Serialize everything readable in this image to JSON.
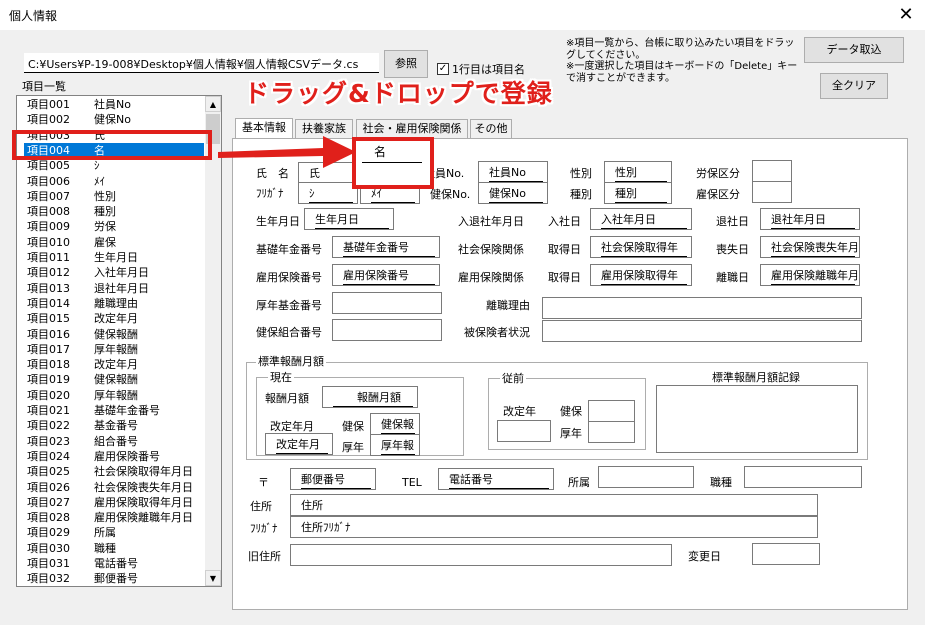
{
  "window": {
    "title": "個人情報",
    "close_icon": "close-icon"
  },
  "top": {
    "path_value": "C:¥Users¥P-19-008¥Desktop¥個人情報¥個人情報CSVデータ.cs",
    "browse_label": "参照",
    "first_row_label": "1行目は項目名",
    "first_row_checked": true,
    "note_line1": "※項目一覧から、台帳に取り込みたい項目をドラッ",
    "note_line2": "グしてください。",
    "note_line3": "※一度選択した項目はキーボードの「Delete」キー",
    "note_line4": "で消すことができます。",
    "import_label": "データ取込",
    "clear_label": "全クリア"
  },
  "item_list": {
    "title": "項目一覧",
    "rows": [
      {
        "id": "項目001",
        "name": "社員No"
      },
      {
        "id": "項目002",
        "name": "健保No"
      },
      {
        "id": "項目003",
        "name": "氏"
      },
      {
        "id": "項目004",
        "name": "名"
      },
      {
        "id": "項目005",
        "name": "ｼ"
      },
      {
        "id": "項目006",
        "name": "ﾒｲ"
      },
      {
        "id": "項目007",
        "name": "性別"
      },
      {
        "id": "項目008",
        "name": "種別"
      },
      {
        "id": "項目009",
        "name": "労保"
      },
      {
        "id": "項目010",
        "name": "雇保"
      },
      {
        "id": "項目011",
        "name": "生年月日"
      },
      {
        "id": "項目012",
        "name": "入社年月日"
      },
      {
        "id": "項目013",
        "name": "退社年月日"
      },
      {
        "id": "項目014",
        "name": "離職理由"
      },
      {
        "id": "項目015",
        "name": "改定年月"
      },
      {
        "id": "項目016",
        "name": "健保報酬"
      },
      {
        "id": "項目017",
        "name": "厚年報酬"
      },
      {
        "id": "項目018",
        "name": "改定年月"
      },
      {
        "id": "項目019",
        "name": "健保報酬"
      },
      {
        "id": "項目020",
        "name": "厚年報酬"
      },
      {
        "id": "項目021",
        "name": "基礎年金番号"
      },
      {
        "id": "項目022",
        "name": "基金番号"
      },
      {
        "id": "項目023",
        "name": "組合番号"
      },
      {
        "id": "項目024",
        "name": "雇用保険番号"
      },
      {
        "id": "項目025",
        "name": "社会保険取得年月日"
      },
      {
        "id": "項目026",
        "name": "社会保険喪失年月日"
      },
      {
        "id": "項目027",
        "name": "雇用保険取得年月日"
      },
      {
        "id": "項目028",
        "name": "雇用保険離職年月日"
      },
      {
        "id": "項目029",
        "name": "所属"
      },
      {
        "id": "項目030",
        "name": "職種"
      },
      {
        "id": "項目031",
        "name": "電話番号"
      },
      {
        "id": "項目032",
        "name": "郵便番号"
      }
    ],
    "selected_index": 3,
    "scroll_up_icon": "triangle-up-icon",
    "scroll_down_icon": "triangle-down-icon"
  },
  "overlay": {
    "instruction": "ドラッグ&ドロップで登録",
    "arrow_icon": "right-arrow-icon",
    "drop_value": "名"
  },
  "tabs": [
    "基本情報",
    "扶養家族",
    "社会・雇用保険関係",
    "その他"
  ],
  "form": {
    "name_label": "氏　名",
    "surname": "氏",
    "kana_label": "ﾌﾘｶﾞﾅ",
    "kana_surname": "ｼ",
    "kana_given": "ﾒｲ",
    "emp_no_label": "社員No.",
    "emp_no": "社員No",
    "health_no_label": "健保No.",
    "health_no": "健保No",
    "gender_label": "性別",
    "gender": "性別",
    "type_label": "種別",
    "type": "種別",
    "labor_label": "労保区分",
    "employ_ins_label": "雇保区分",
    "birth_label": "生年月日",
    "birth": "生年月日",
    "join_retire_label": "入退社年月日",
    "join_label": "入社日",
    "join": "入社年月日",
    "retire_label": "退社日",
    "retire": "退社年月日",
    "pension_no_label": "基礎年金番号",
    "pension_no": "基礎年金番号",
    "social_ins_label": "社会保険関係",
    "acquire_label": "取得日",
    "social_acquire": "社会保険取得年",
    "loss_label": "喪失日",
    "social_loss": "社会保険喪失年月",
    "emp_ins_no_label": "雇用保険番号",
    "emp_ins_no": "雇用保険番号",
    "emp_ins_rel_label": "雇用保険関係",
    "emp_acquire": "雇用保険取得年",
    "leave_label": "離職日",
    "emp_leave": "雇用保険離職年月",
    "fund_no_label": "厚年基金番号",
    "union_no_label": "健保組合番号",
    "leave_reason_label": "離職理由",
    "insured_status_label": "被保険者状況",
    "std_group_title": "標準報酬月額",
    "current_title": "現在",
    "salary_label": "報酬月額",
    "salary": "報酬月額",
    "revision_label": "改定年月",
    "revision": "改定年月",
    "health_label": "健保",
    "health_value": "健保報",
    "pension_label": "厚年",
    "pension_value": "厚年報",
    "previous_title": "従前",
    "prev_revision_label": "改定年",
    "prev_health_label": "健保",
    "prev_pension_label": "厚年",
    "record_title": "標準報酬月額記録",
    "zip_label": "〒",
    "zip": "郵便番号",
    "tel_label": "TEL",
    "tel": "電話番号",
    "dept_label": "所属",
    "job_label": "職種",
    "address_label": "住所",
    "address": "住所",
    "address_kana_label": "ﾌﾘｶﾞﾅ",
    "address_kana": "住所ﾌﾘｶﾞﾅ",
    "old_address_label": "旧住所",
    "change_date_label": "変更日"
  }
}
